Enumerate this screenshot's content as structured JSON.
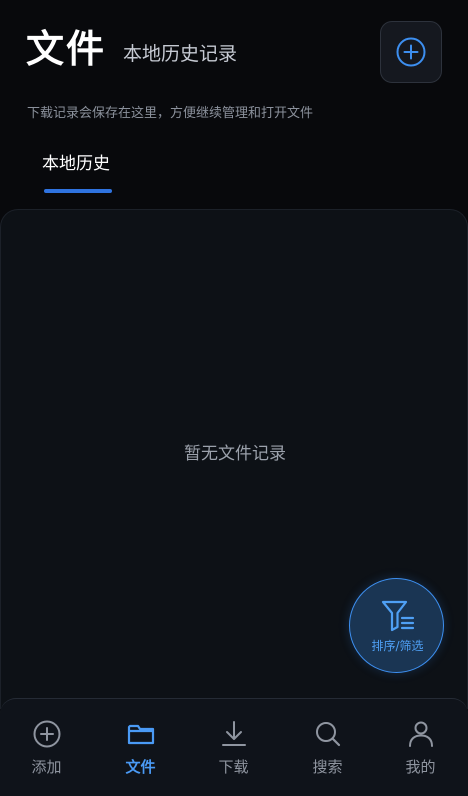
{
  "header": {
    "title": "文件",
    "subtitle": "本地历史记录",
    "description": "下载记录会保存在这里，方便继续管理和打开文件",
    "add_icon": "plus-circle-icon"
  },
  "tabs": [
    {
      "label": "本地历史",
      "active": true
    }
  ],
  "content": {
    "empty_text": "暂无文件记录"
  },
  "fab": {
    "label": "排序/筛选",
    "icon": "filter-list-icon"
  },
  "bottom_nav": {
    "items": [
      {
        "label": "添加",
        "icon": "plus-circle-icon",
        "active": false
      },
      {
        "label": "文件",
        "icon": "folder-icon",
        "active": true
      },
      {
        "label": "下载",
        "icon": "download-icon",
        "active": false
      },
      {
        "label": "搜索",
        "icon": "search-icon",
        "active": false
      },
      {
        "label": "我的",
        "icon": "user-icon",
        "active": false
      }
    ]
  },
  "colors": {
    "background": "#08090c",
    "panel": "#0d1116",
    "accent": "#2f73e0",
    "accent_light": "#4a9af5",
    "nav_inactive": "#8f95a0"
  }
}
